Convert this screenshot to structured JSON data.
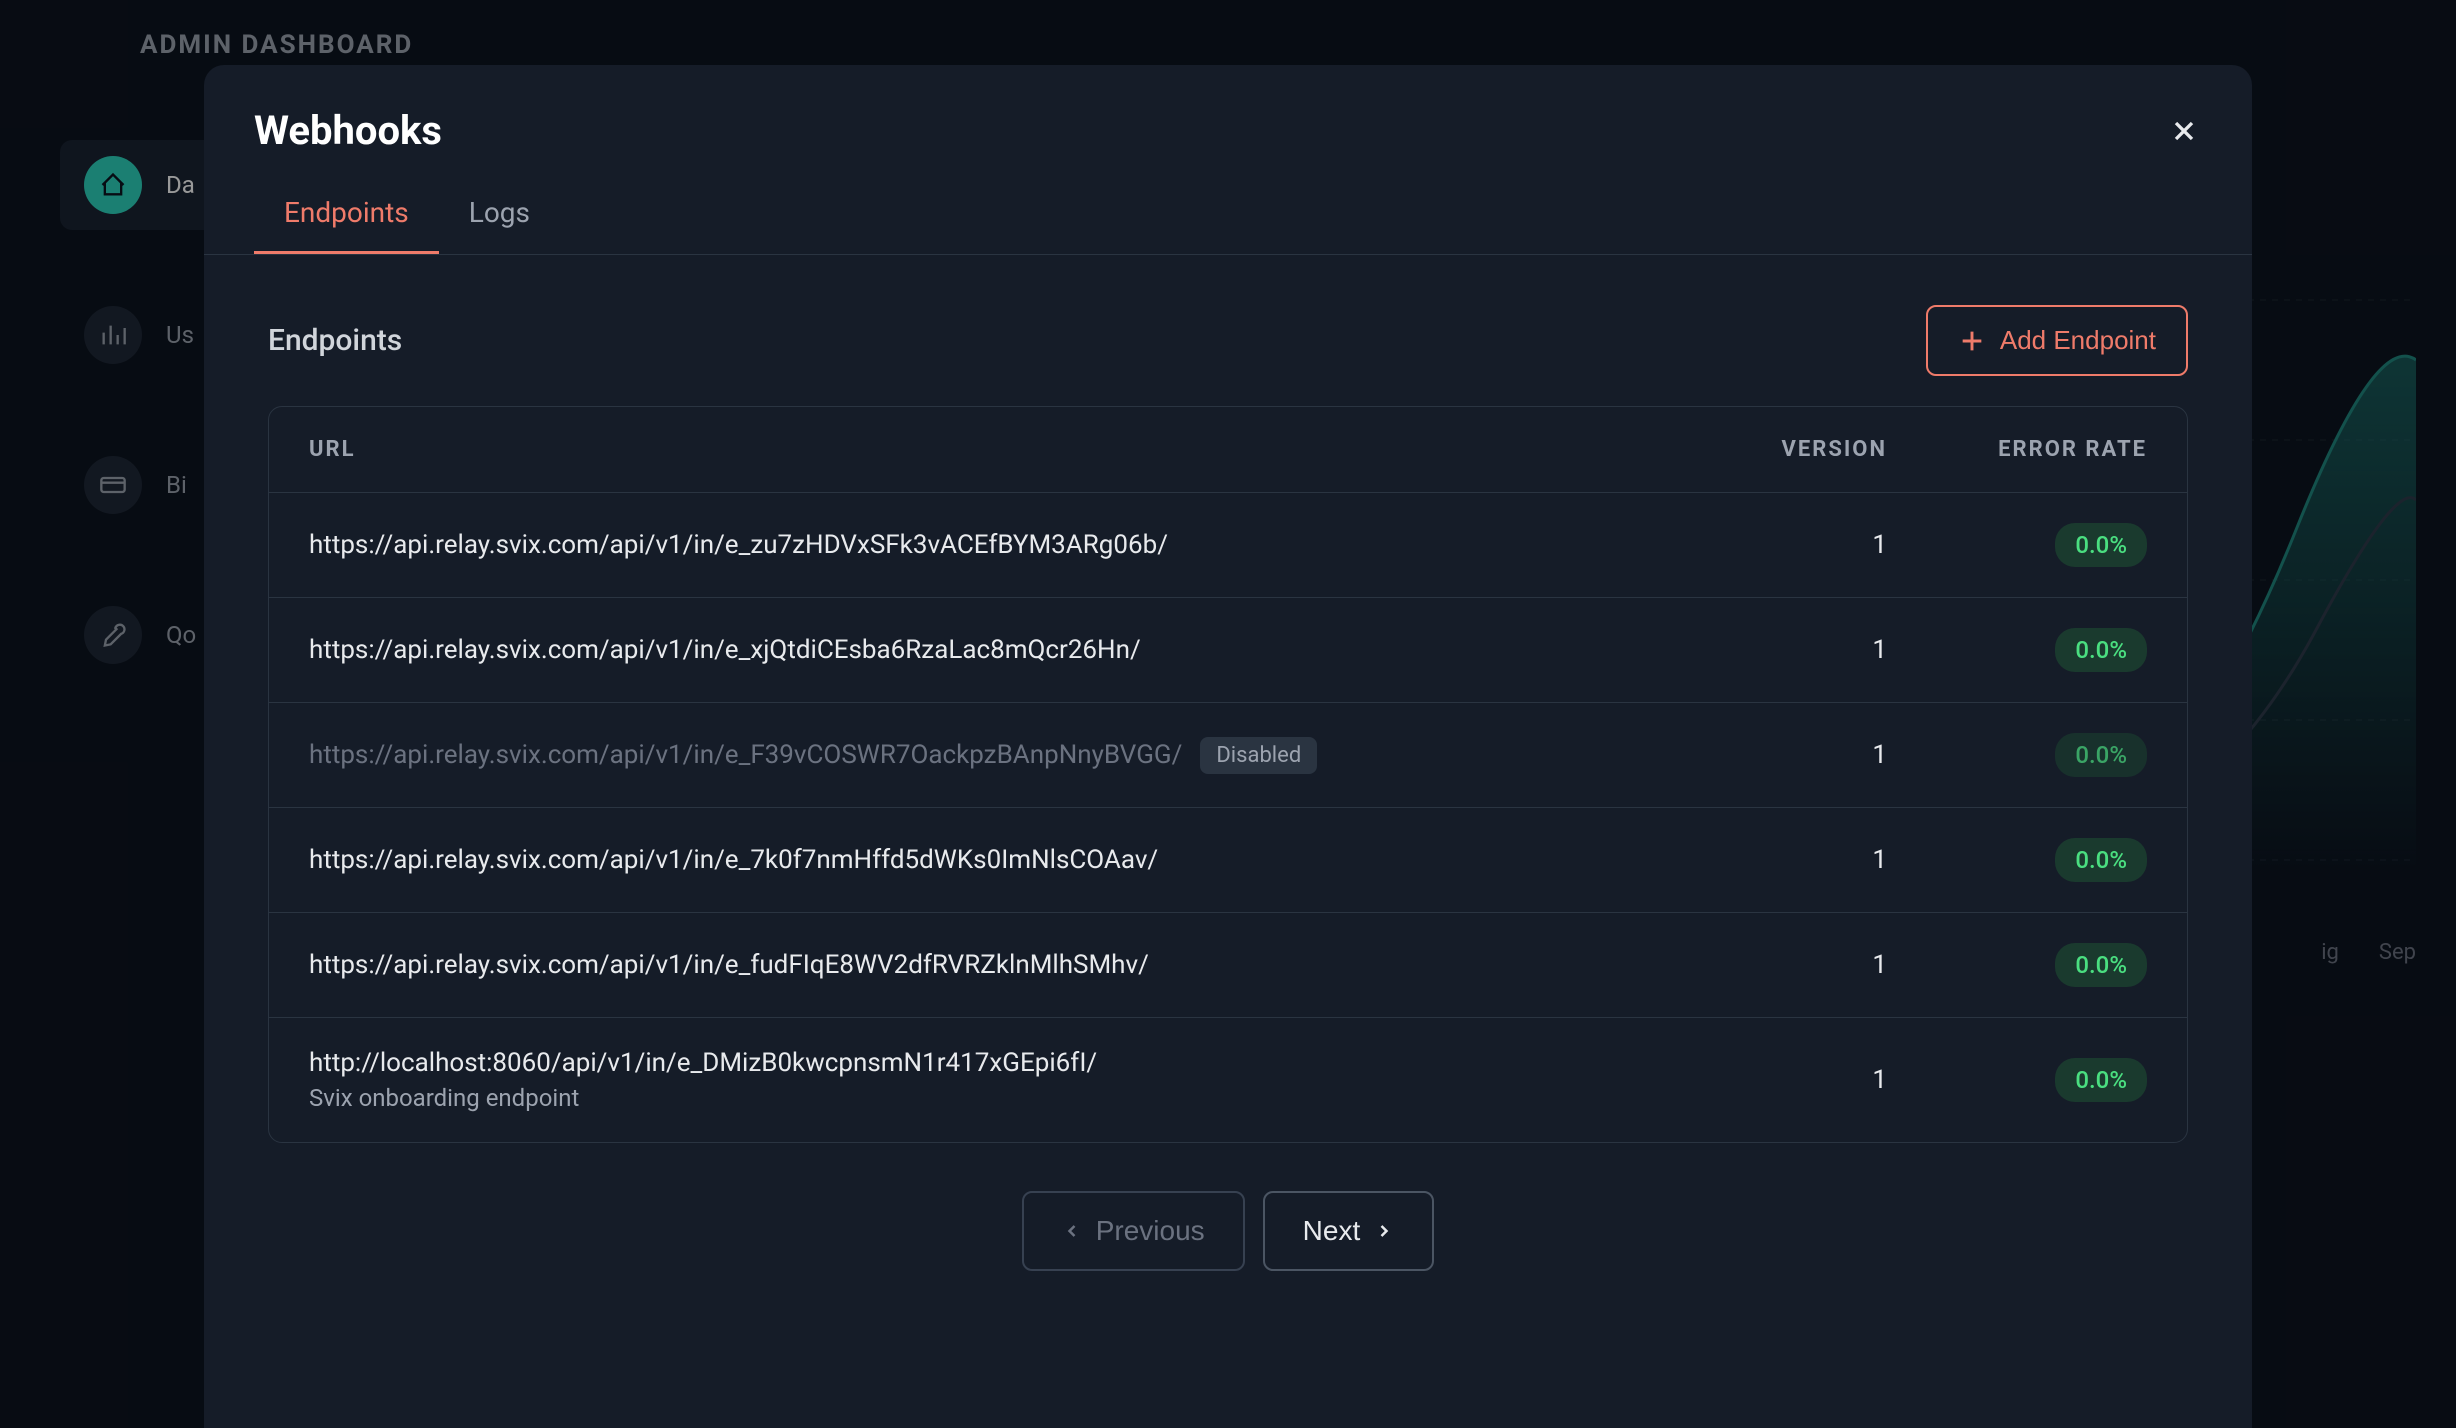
{
  "bg": {
    "header": "ADMIN DASHBOARD",
    "sidebar": [
      {
        "label": "Da",
        "icon": "home"
      },
      {
        "label": "Us",
        "icon": "chart"
      },
      {
        "label": "Bi",
        "icon": "card"
      },
      {
        "label": "Qo",
        "icon": "wrench"
      }
    ],
    "months": [
      "ig",
      "Sep"
    ]
  },
  "modal": {
    "title": "Webhooks",
    "tabs": [
      {
        "label": "Endpoints",
        "active": true
      },
      {
        "label": "Logs",
        "active": false
      }
    ],
    "section_title": "Endpoints",
    "add_button": "Add Endpoint",
    "columns": {
      "url": "URL",
      "version": "VERSION",
      "error_rate": "ERROR RATE"
    },
    "rows": [
      {
        "url": "https://api.relay.svix.com/api/v1/in/e_zu7zHDVxSFk3vACEfBYM3ARg06b/",
        "version": "1",
        "error_rate": "0.0%",
        "disabled": false
      },
      {
        "url": "https://api.relay.svix.com/api/v1/in/e_xjQtdiCEsba6RzaLac8mQcr26Hn/",
        "version": "1",
        "error_rate": "0.0%",
        "disabled": false
      },
      {
        "url": "https://api.relay.svix.com/api/v1/in/e_F39vCOSWR7OackpzBAnpNnyBVGG/",
        "version": "1",
        "error_rate": "0.0%",
        "disabled": true
      },
      {
        "url": "https://api.relay.svix.com/api/v1/in/e_7k0f7nmHffd5dWKs0ImNlsCOAav/",
        "version": "1",
        "error_rate": "0.0%",
        "disabled": false
      },
      {
        "url": "https://api.relay.svix.com/api/v1/in/e_fudFIqE8WV2dfRVRZklnMlhSMhv/",
        "version": "1",
        "error_rate": "0.0%",
        "disabled": false
      },
      {
        "url": "http://localhost:8060/api/v1/in/e_DMizB0kwcpnsmN1r417xGEpi6fI/",
        "description": "Svix onboarding endpoint",
        "version": "1",
        "error_rate": "0.0%",
        "disabled": false
      }
    ],
    "disabled_label": "Disabled",
    "pagination": {
      "previous": "Previous",
      "next": "Next"
    }
  }
}
